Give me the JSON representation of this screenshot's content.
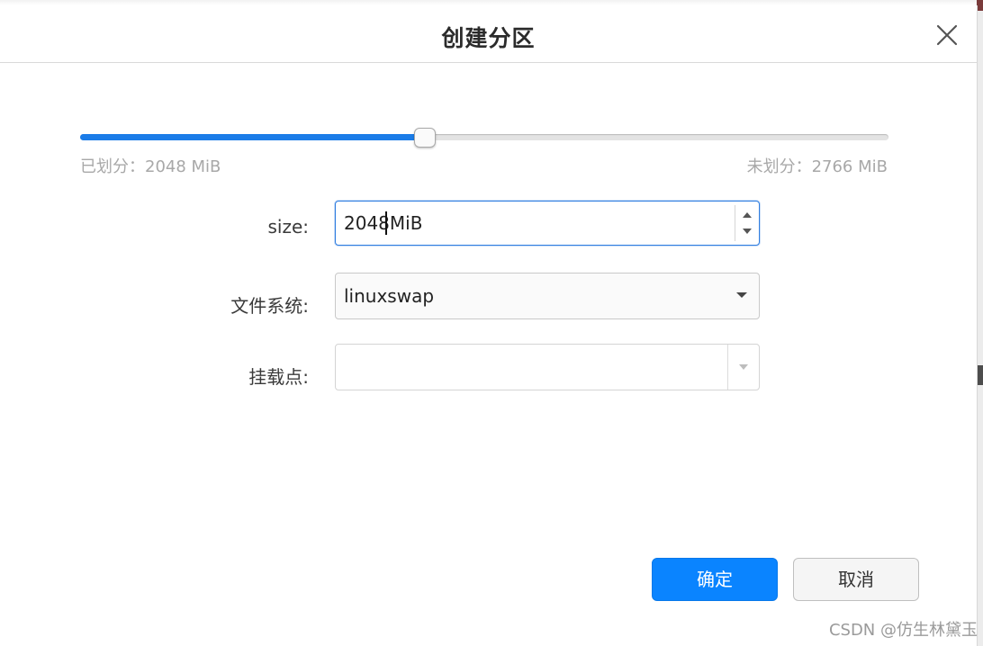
{
  "dialog": {
    "title": "创建分区",
    "close_icon": "close-icon"
  },
  "slider": {
    "fraction": 0.4255,
    "used_label": "已划分：2048 MiB",
    "free_label": "未划分：2766 MiB",
    "accent_color": "#1b7ce8"
  },
  "form": {
    "size": {
      "label": "size:",
      "value": "2048MiB",
      "up_icon": "chevron-up-icon",
      "down_icon": "chevron-down-icon"
    },
    "filesystem": {
      "label": "文件系统:",
      "value": "linuxswap",
      "arrow_icon": "dropdown-arrow-icon"
    },
    "mountpoint": {
      "label": "挂载点:",
      "value": "",
      "arrow_icon": "dropdown-arrow-icon"
    }
  },
  "buttons": {
    "ok_label": "确定",
    "cancel_label": "取消",
    "ok_color": "#0a84ff"
  },
  "watermark": "CSDN @仿生林黛玉"
}
